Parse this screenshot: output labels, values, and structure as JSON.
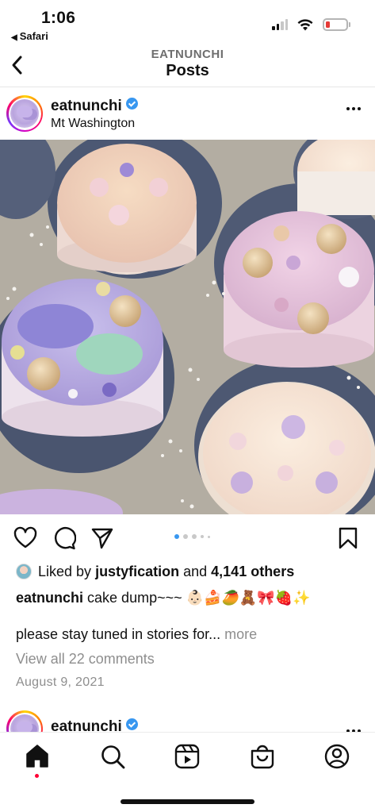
{
  "status_bar": {
    "time": "1:06",
    "back_app": "Safari",
    "signal_bars_on": 2,
    "battery_color": "#e53935"
  },
  "header": {
    "subtitle": "EATNUNCHI",
    "title": "Posts",
    "back_icon": "chevron-left-icon"
  },
  "post": {
    "username": "eatnunchi",
    "verified": true,
    "location": "Mt Washington",
    "more_icon": "ellipsis-icon",
    "photo_subject": "jelly cakes",
    "carousel": {
      "count": 5,
      "active_index": 0
    },
    "liked_by_prefix": "Liked by",
    "liked_by_user": "justyfication",
    "liked_by_and": "and",
    "liked_by_others": "4,141 others",
    "caption_user": "eatnunchi",
    "caption_text": "cake dump~~~ 👶🏻🍰🥭🧸🎀🍓✨",
    "caption_line2": "please stay tuned in stories for...",
    "caption_more": "more",
    "view_comments": "View all 22 comments",
    "date": "August 9, 2021"
  },
  "next_post": {
    "username": "eatnunchi",
    "verified": true
  },
  "tab_bar": {
    "items": [
      "home-icon",
      "search-icon",
      "reels-icon",
      "shop-icon",
      "profile-icon"
    ],
    "active": "home-icon",
    "notification_color": "#ff0034"
  },
  "colors": {
    "accent_blue": "#3897f0",
    "muted_text": "#8e8e8e"
  }
}
